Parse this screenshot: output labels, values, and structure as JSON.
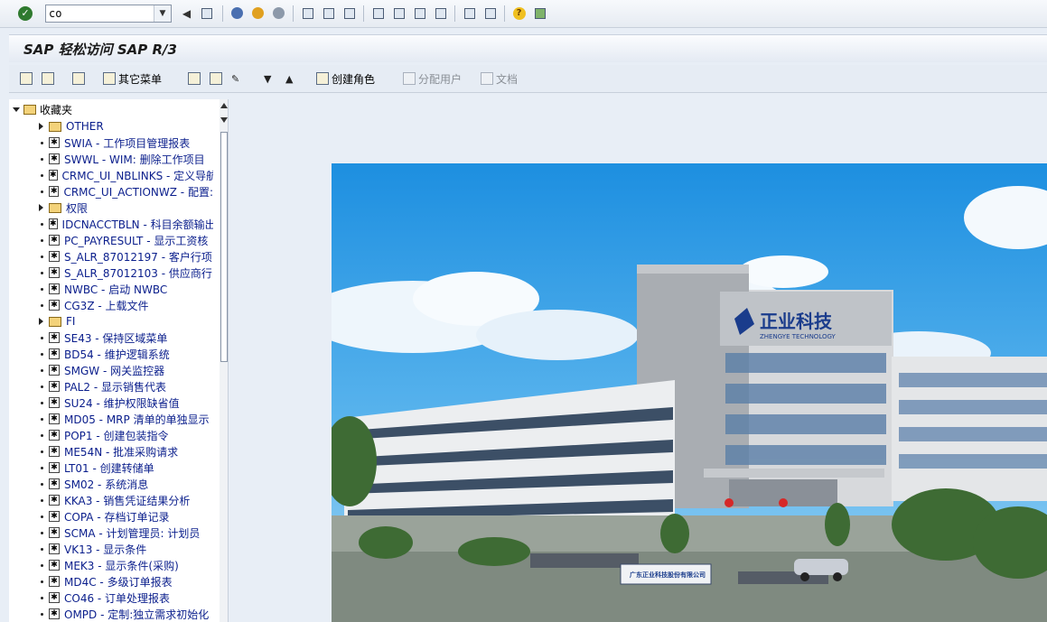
{
  "systoolbar": {
    "command_value": "co"
  },
  "title": "SAP 轻松访问 SAP R/3",
  "app_toolbar": {
    "other_menu_label": "其它菜单",
    "create_role_label": "创建角色",
    "assign_users_label": "分配用户",
    "documentation_label": "文档"
  },
  "tree": {
    "root_label": "收藏夹",
    "items": [
      {
        "type": "folder",
        "label": "OTHER"
      },
      {
        "type": "txn",
        "label": "SWIA - 工作项目管理报表"
      },
      {
        "type": "txn",
        "label": "SWWL - WIM: 删除工作项目"
      },
      {
        "type": "txn",
        "label": "CRMC_UI_NBLINKS - 定义导航"
      },
      {
        "type": "txn",
        "label": "CRMC_UI_ACTIONWZ - 配置:"
      },
      {
        "type": "folder",
        "label": "权限"
      },
      {
        "type": "txn",
        "label": "IDCNACCTBLN - 科目余额输出"
      },
      {
        "type": "txn",
        "label": "PC_PAYRESULT - 显示工资核"
      },
      {
        "type": "txn",
        "label": "S_ALR_87012197 - 客户行项"
      },
      {
        "type": "txn",
        "label": "S_ALR_87012103 - 供应商行"
      },
      {
        "type": "txn",
        "label": "NWBC - 启动 NWBC"
      },
      {
        "type": "txn",
        "label": "CG3Z - 上载文件"
      },
      {
        "type": "folder",
        "label": "FI"
      },
      {
        "type": "txn",
        "label": "SE43 - 保持区域菜单"
      },
      {
        "type": "txn",
        "label": "BD54 - 维护逻辑系统"
      },
      {
        "type": "txn",
        "label": "SMGW - 网关监控器"
      },
      {
        "type": "txn",
        "label": "PAL2 - 显示销售代表"
      },
      {
        "type": "txn",
        "label": "SU24 - 维护权限缺省值"
      },
      {
        "type": "txn",
        "label": "MD05 - MRP 清单的单独显示"
      },
      {
        "type": "txn",
        "label": "POP1 - 创建包装指令"
      },
      {
        "type": "txn",
        "label": "ME54N - 批准采购请求"
      },
      {
        "type": "txn",
        "label": "LT01 - 创建转储单"
      },
      {
        "type": "txn",
        "label": "SM02 - 系统消息"
      },
      {
        "type": "txn",
        "label": "KKA3 - 销售凭证结果分析"
      },
      {
        "type": "txn",
        "label": "COPA - 存档订单记录"
      },
      {
        "type": "txn",
        "label": "SCMA - 计划管理员: 计划员"
      },
      {
        "type": "txn",
        "label": "VK13 - 显示条件"
      },
      {
        "type": "txn",
        "label": "MEK3 - 显示条件(采购)"
      },
      {
        "type": "txn",
        "label": "MD4C - 多级订单报表"
      },
      {
        "type": "txn",
        "label": "CO46 - 订单处理报表"
      },
      {
        "type": "txn",
        "label": "OMPD - 定制:独立需求初始化"
      }
    ]
  },
  "photo": {
    "building_sign": "正业科技",
    "building_sign_en": "ZHENGYE TECHNOLOGY",
    "gate_sign": "广东正业科技股份有限公司"
  }
}
